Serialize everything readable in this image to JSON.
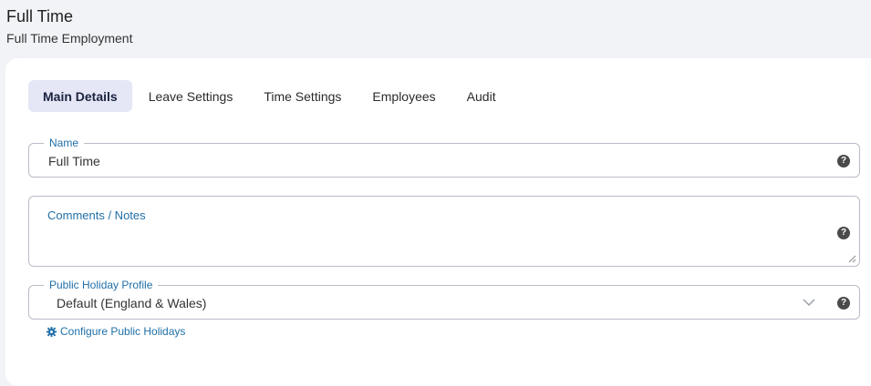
{
  "header": {
    "title": "Full Time",
    "subtitle": "Full Time Employment"
  },
  "tabs": [
    {
      "label": "Main Details",
      "active": true
    },
    {
      "label": "Leave Settings",
      "active": false
    },
    {
      "label": "Time Settings",
      "active": false
    },
    {
      "label": "Employees",
      "active": false
    },
    {
      "label": "Audit",
      "active": false
    }
  ],
  "form": {
    "name": {
      "label": "Name",
      "value": "Full Time"
    },
    "comments": {
      "label": "Comments / Notes",
      "value": ""
    },
    "holiday_profile": {
      "label": "Public Holiday Profile",
      "value": "Default (England & Wales)"
    }
  },
  "help_icon_glyph": "?",
  "configure_link": "Configure Public Holidays",
  "icons": {
    "help": "question-circle-icon",
    "dropdown": "chevron-down-icon",
    "configure": "gear-icon"
  },
  "colors": {
    "accent": "#1f6fa8",
    "active_tab_bg": "#e5e7f6",
    "page_bg": "#f2f3f7"
  }
}
